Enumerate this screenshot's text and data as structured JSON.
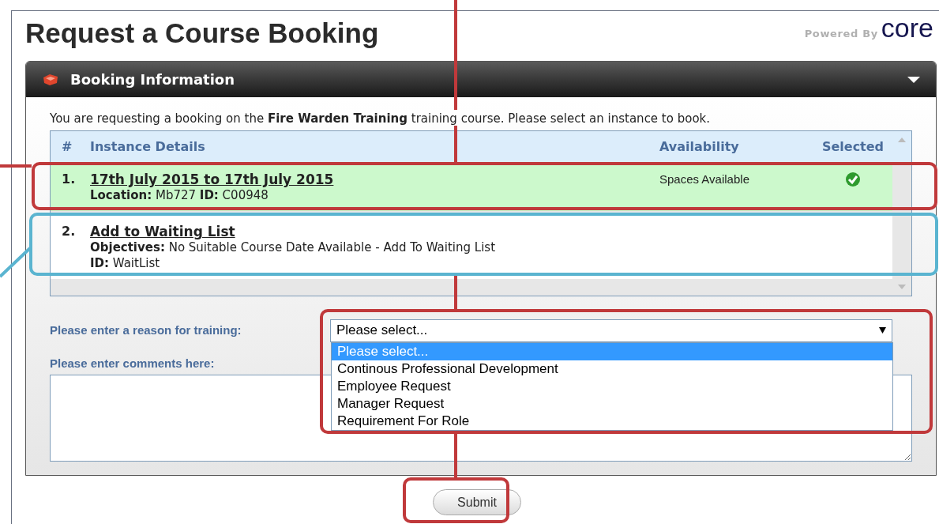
{
  "page_title": "Request a Course Booking",
  "powered_by": {
    "label": "Powered By",
    "logo": "core"
  },
  "panel": {
    "title": "Booking Information",
    "expanded": true
  },
  "intro": "You are requesting a booking on the **Fire Warden Training** training course. Please select an instance to book.",
  "table": {
    "columns": [
      "#",
      "Instance Details",
      "Availability",
      "Selected"
    ],
    "rows": [
      {
        "number": "1.",
        "title": "17th July 2015 to 17th July 2015",
        "lines": [
          "**Location:** Mb727 **ID:** C00948"
        ],
        "availability": "Spaces Available",
        "selected": true
      },
      {
        "number": "2.",
        "title": "Add to Waiting List",
        "lines": [
          "**Objectives:** No Suitable Course Date Available - Add To Waiting List",
          "**ID:** WaitList"
        ],
        "selected": false
      }
    ]
  },
  "reason": {
    "label": "Please enter a reason for training:",
    "value": "Please select...",
    "expanded": true,
    "options": [
      {
        "label": "Please select...",
        "selected": true
      },
      {
        "label": "Continous Professional Development",
        "selected": false
      },
      {
        "label": "Employee Request",
        "selected": false
      },
      {
        "label": "Manager Request",
        "selected": false
      },
      {
        "label": "Requirement For Role",
        "selected": false
      }
    ]
  },
  "comments": {
    "label": "Please enter comments here:"
  },
  "submit": "Submit",
  "callouts": [
    {
      "color": "#c0393b"
    },
    {
      "color": "#5ab4d0"
    },
    {
      "color": "#c0393b"
    },
    {
      "color": "#c0393b"
    }
  ]
}
